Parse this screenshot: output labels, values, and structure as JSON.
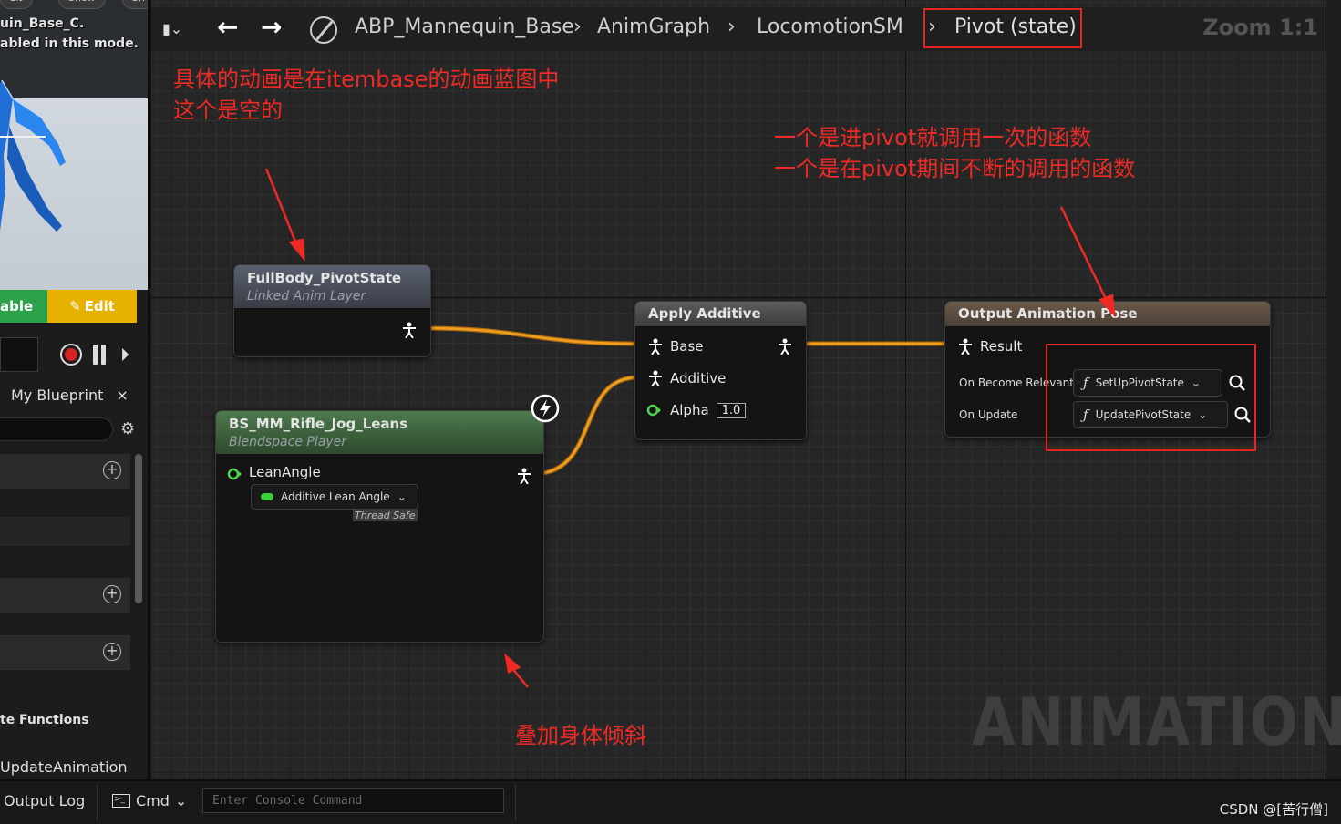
{
  "left_panel": {
    "viewport_buttons": [
      "Lit",
      "Show",
      "Sh"
    ],
    "viewport_info_line1": "uin_Base_C.",
    "viewport_info_line2": "abled in this mode.",
    "enable_label": "able",
    "edit_label": "Edit",
    "my_blueprint_tab": "My Blueprint",
    "functions_header": "te Functions",
    "function_item": "UpdateAnimation"
  },
  "toolbar": {
    "breadcrumb": [
      "ABP_Mannequin_Base",
      "AnimGraph",
      "LocomotionSM",
      "Pivot (state)"
    ],
    "zoom": "Zoom 1:1"
  },
  "nodes": {
    "linked_layer": {
      "title": "FullBody_PivotState",
      "subtitle": "Linked Anim Layer"
    },
    "blendspace": {
      "title": "BS_MM_Rifle_Jog_Leans",
      "subtitle": "Blendspace Player",
      "pin_label": "LeanAngle",
      "pin_value": "Additive Lean Angle",
      "thread_safe": "Thread Safe"
    },
    "apply_additive": {
      "title": "Apply Additive",
      "pin_base": "Base",
      "pin_additive": "Additive",
      "pin_alpha": "Alpha",
      "alpha_value": "1.0"
    },
    "output_pose": {
      "title": "Output Animation Pose",
      "pin_result": "Result",
      "on_become_relevant_label": "On Become Relevant",
      "on_become_relevant_fn": "SetUpPivotState",
      "on_update_label": "On Update",
      "on_update_fn": "UpdatePivotState"
    }
  },
  "annotations": {
    "top_left_line1": "具体的动画是在itembase的动画蓝图中",
    "top_left_line2": "这个是空的",
    "top_right_line1": "一个是进pivot就调用一次的函数",
    "top_right_line2": "一个是在pivot期间不断的调用的函数",
    "bottom": "叠加身体倾斜"
  },
  "watermark": "ANIMATION",
  "bottom_bar": {
    "output_log": "Output Log",
    "cmd_label": "Cmd",
    "console_placeholder": "Enter Console Command",
    "credit": "CSDN @[苦行僧]"
  },
  "colors": {
    "pose_wire": "#f0a020",
    "annotation_red": "#ee2a25",
    "enable_green": "#2aa14a",
    "edit_yellow": "#e7b100",
    "linked_layer_header": "#5a6070",
    "blendspace_header": "#4f7a4f",
    "apply_additive_header": "#5c5c5c",
    "output_pose_header": "#6a5a4a"
  }
}
